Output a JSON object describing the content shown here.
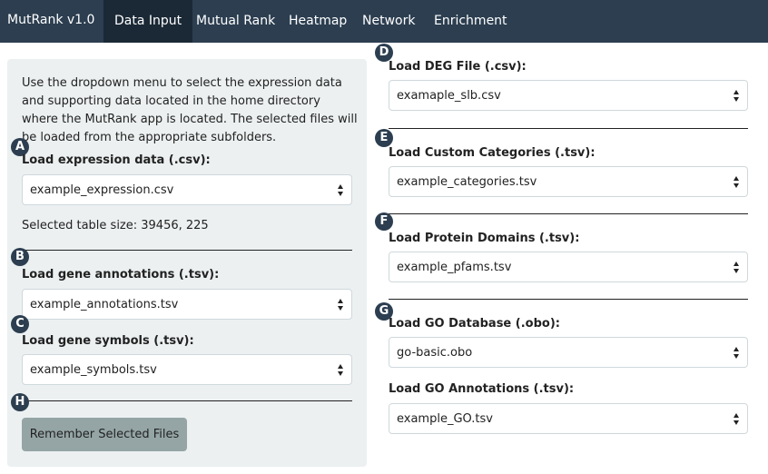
{
  "nav": {
    "brand": "MutRank v1.0",
    "tabs": [
      {
        "label": "Data Input",
        "active": true
      },
      {
        "label": "Mutual Rank"
      },
      {
        "label": "Heatmap"
      },
      {
        "label": "Network"
      },
      {
        "label": "Enrichment"
      }
    ]
  },
  "sidebar": {
    "intro": "Use the dropdown menu to select the expression data and supporting data located in the home directory where the MutRank app is located. The selected files will be loaded from the appropriate subfolders.",
    "expression": {
      "badge": "A",
      "label": "Load expression data (.csv):",
      "value": "example_expression.csv"
    },
    "table_size": "Selected table size: 39456, 225",
    "annotations": {
      "badge": "B",
      "label": "Load gene annotations (.tsv):",
      "value": "example_annotations.tsv"
    },
    "symbols": {
      "badge": "C",
      "label": "Load gene symbols (.tsv):",
      "value": "example_symbols.tsv"
    },
    "remember": {
      "badge": "H",
      "button": "Remember Selected Files"
    }
  },
  "main": {
    "deg": {
      "badge": "D",
      "label": "Load DEG File (.csv):",
      "value": "examaple_slb.csv"
    },
    "categories": {
      "badge": "E",
      "label": "Load Custom Categories (.tsv):",
      "value": "example_categories.tsv"
    },
    "domains": {
      "badge": "F",
      "label": "Load Protein Domains (.tsv):",
      "value": "example_pfams.tsv"
    },
    "go_db": {
      "badge": "G",
      "label": "Load GO Database (.obo):",
      "value": "go-basic.obo"
    },
    "go_annotations": {
      "label": "Load GO Annotations (.tsv):",
      "value": "example_GO.tsv"
    }
  },
  "colors": {
    "navbar": "#2c3e50",
    "active_tab": "#1b2936",
    "panel": "#ecf0f1",
    "button": "#95a5a6",
    "badge": "#2c3e50"
  }
}
